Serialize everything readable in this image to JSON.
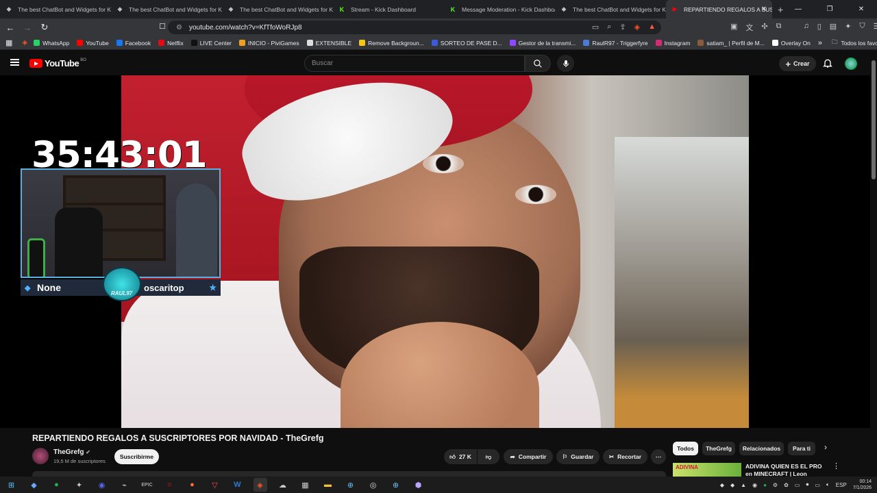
{
  "browser": {
    "tabs": [
      {
        "title": "The best ChatBot and Widgets for Ki",
        "icon": "kick-widget-icon",
        "active": false
      },
      {
        "title": "The best ChatBot and Widgets for Ki",
        "icon": "kick-widget-icon",
        "active": false
      },
      {
        "title": "The best ChatBot and Widgets for Ki",
        "icon": "kick-widget-icon",
        "active": false
      },
      {
        "title": "Stream - Kick Dashboard",
        "icon": "kick-icon",
        "active": false
      },
      {
        "title": "Message Moderation - Kick Dashboa",
        "icon": "kick-icon",
        "active": false
      },
      {
        "title": "The best ChatBot and Widgets for Ki",
        "icon": "kick-widget-icon",
        "active": false
      },
      {
        "title": "REPARTIENDO REGALOS A SUSC",
        "icon": "youtube-icon",
        "active": true
      }
    ],
    "new_tab": "+",
    "url": "youtube.com/watch?v=KfTfoWoRJp8",
    "bookmarks": [
      {
        "label": "WhatsApp",
        "color": "#25d366"
      },
      {
        "label": "YouTube",
        "color": "#ff0000"
      },
      {
        "label": "Facebook",
        "color": "#1877f2"
      },
      {
        "label": "Netflix",
        "color": "#e50914"
      },
      {
        "label": "LIVE Center",
        "color": "#111111"
      },
      {
        "label": "INICIO - PiviGames",
        "color": "#f0a020"
      },
      {
        "label": "EXTENSIBLE",
        "color": "#dddddd"
      },
      {
        "label": "Remove Backgroun...",
        "color": "#f5c518"
      },
      {
        "label": "SORTEO DE PASE D...",
        "color": "#3b5bdb"
      },
      {
        "label": "Gestor de la transmi...",
        "color": "#9146ff"
      },
      {
        "label": "RaulR97 - Triggerfyre",
        "color": "#4a7bd6"
      },
      {
        "label": "Instagram",
        "color": "#d62976"
      },
      {
        "label": "satiam_ | Perfil de M...",
        "color": "#8b5a3c"
      },
      {
        "label": "Overlay On",
        "color": "#ffffff"
      }
    ],
    "bookmarks_more": "»",
    "all_bookmarks": "Todos los favoritos"
  },
  "youtube": {
    "logo": "YouTube",
    "country": "BO",
    "search_placeholder": "Buscar",
    "create_label": "Crear",
    "video_title": "REPARTIENDO REGALOS A SUSCRIPTORES POR NAVIDAD - TheGrefg",
    "channel_name": "TheGrefg",
    "subscribers": "19,5 M de suscriptores",
    "subscribe_label": "Suscribirme",
    "likes": "27 K",
    "share_label": "Compartir",
    "save_label": "Guardar",
    "clip_label": "Recortar",
    "chips": [
      "Todos",
      "TheGrefg",
      "Relacionados",
      "Para ti"
    ],
    "related_title": "ADIVINA QUIEN ES EL PRO en MINECRAFT | Leon Farman",
    "related_thumb_text": "ADIVINA"
  },
  "overlay": {
    "timer": "35:43:01",
    "left_name": "None",
    "right_name": "oscaritop",
    "logo_text": "RAUL97"
  },
  "taskbar": {
    "lang": "ESP",
    "time": "00:14",
    "date": "7/1/2026"
  }
}
